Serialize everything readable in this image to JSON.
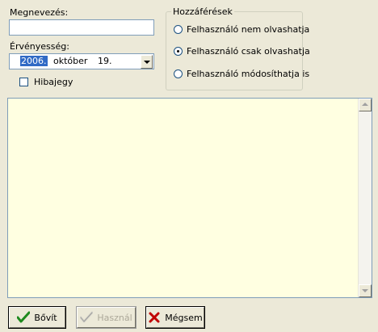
{
  "form": {
    "name_label": "Megnevezés:",
    "name_value": "",
    "validity_label": "Érvényesség:",
    "date": {
      "year": "2006.",
      "month": "október",
      "day": "19."
    },
    "ticket_label": "Hibajegy",
    "ticket_checked": false
  },
  "access": {
    "title": "Hozzáférések",
    "options": [
      {
        "label": "Felhasználó nem olvashatja",
        "selected": false
      },
      {
        "label": "Felhasználó csak olvashatja",
        "selected": true
      },
      {
        "label": "Felhasználó módosíthatja is",
        "selected": false
      }
    ]
  },
  "memo": {
    "value": ""
  },
  "buttons": {
    "add": {
      "label": "Bővít",
      "icon": "checkmark-icon",
      "color": "#1e8a1e"
    },
    "use": {
      "label": "Használ",
      "icon": "checkmark-icon",
      "enabled": false
    },
    "cancel": {
      "label": "Mégsem",
      "icon": "cross-icon",
      "color": "#c00000"
    }
  },
  "colors": {
    "memo_bg": "#ffffe1",
    "window_bg": "#ece9d8",
    "selection": "#316ac5"
  }
}
